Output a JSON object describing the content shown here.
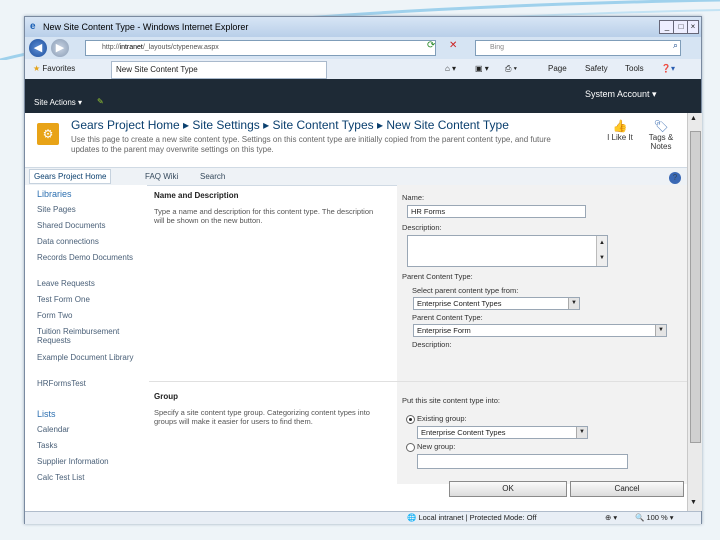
{
  "window": {
    "title": "New Site Content Type - Windows Internet Explorer"
  },
  "address": {
    "url_prefix": "http://",
    "url_host": "intranet",
    "url_path": "/_layouts/ctypenew.aspx",
    "search_placeholder": "Bing"
  },
  "favorites": {
    "label": "Favorites",
    "tab_label": "New Site Content Type"
  },
  "commands": {
    "page": "Page",
    "safety": "Safety",
    "tools": "Tools"
  },
  "ribbon": {
    "site_actions": "Site Actions",
    "account": "System Account"
  },
  "header": {
    "crumbs": [
      "Gears Project Home",
      "Site Settings",
      "Site Content Types",
      "New Site Content Type"
    ],
    "description": "Use this page to create a new site content type. Settings on this content type are initially copied from the parent content type, and future updates to the parent may overwrite settings on this type.",
    "i_like_it": "I Like It",
    "tags_notes": "Tags & Notes"
  },
  "topnav": {
    "items": [
      "Gears Project Home",
      "FAQ Wiki",
      "Search"
    ]
  },
  "quicklaunch": {
    "libraries_heading": "Libraries",
    "libraries": [
      "Site Pages",
      "Shared Documents",
      "Data connections",
      "Records Demo Documents",
      "Leave Requests",
      "Test Form One",
      "Form Two",
      "Tuition Reimbursement Requests",
      "Example Document Library",
      "HRFormsTest"
    ],
    "lists_heading": "Lists",
    "lists": [
      "Calendar",
      "Tasks",
      "Supplier Information",
      "Calc Test List"
    ]
  },
  "form": {
    "name_section_title": "Name and Description",
    "name_section_desc": "Type a name and description for this content type. The description will be shown on the new button.",
    "name_label": "Name:",
    "name_value": "HR Forms",
    "description_label": "Description:",
    "parent_label": "Parent Content Type:",
    "select_parent_label": "Select parent content type from:",
    "parent_group_value": "Enterprise Content Types",
    "parent_type_label": "Parent Content Type:",
    "parent_type_value": "Enterprise Form",
    "parent_desc_label": "Description:",
    "group_section_title": "Group",
    "group_section_desc": "Specify a site content type group. Categorizing content types into groups will make it easier for users to find them.",
    "put_into_label": "Put this site content type into:",
    "existing_group_label": "Existing group:",
    "existing_group_value": "Enterprise Content Types",
    "new_group_label": "New group:",
    "ok": "OK",
    "cancel": "Cancel"
  },
  "status": {
    "zone": "Local intranet | Protected Mode: Off",
    "zoom": "100 %"
  }
}
